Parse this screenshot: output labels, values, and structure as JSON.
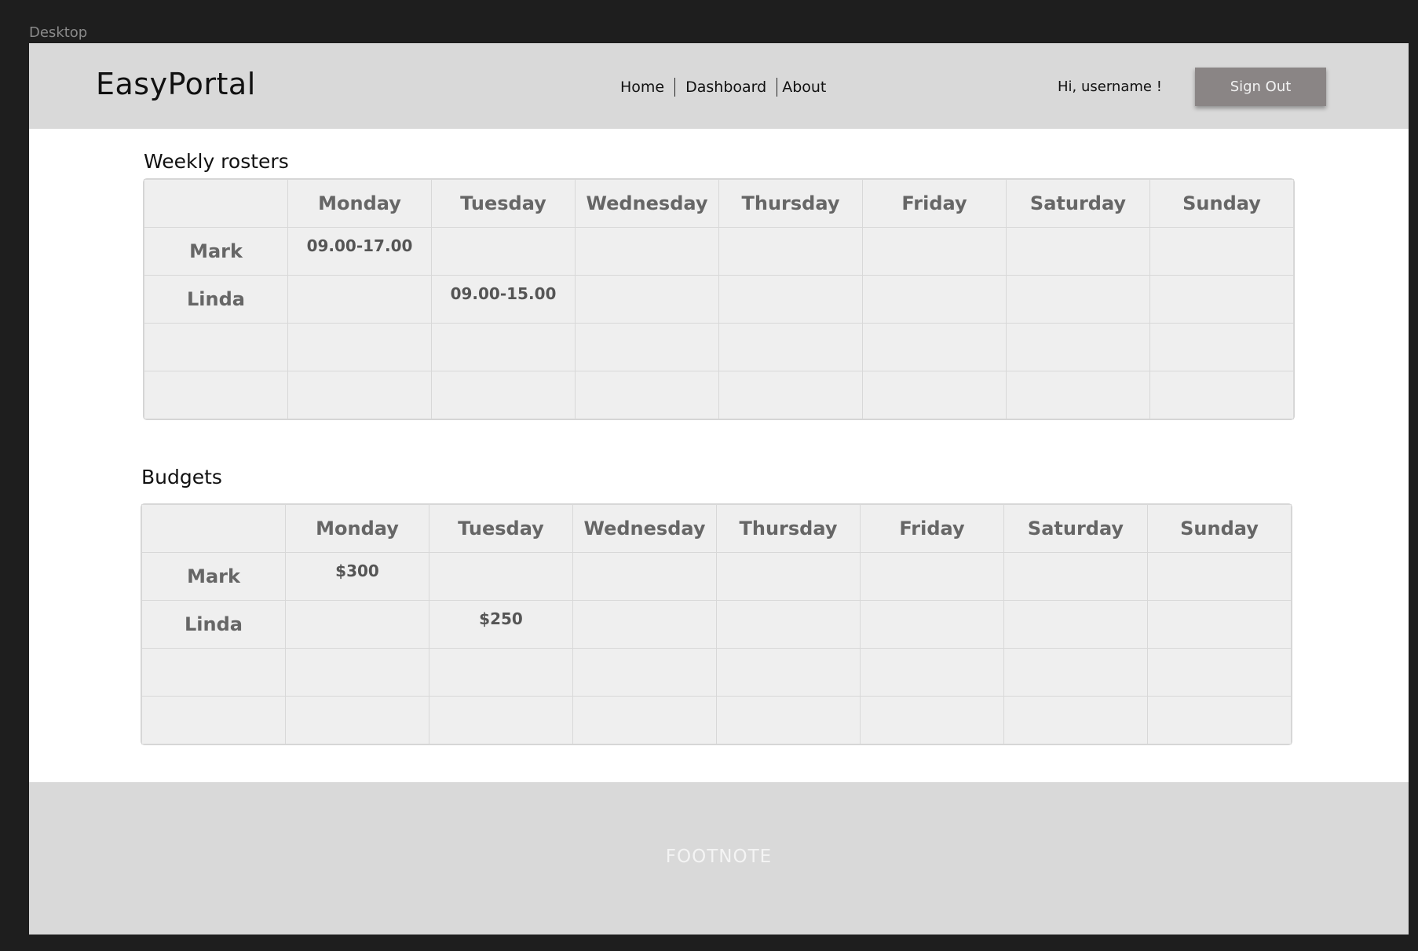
{
  "canvas": {
    "label": "Desktop"
  },
  "header": {
    "logo": "EasyPortal",
    "nav": [
      {
        "label": "Home"
      },
      {
        "label": "Dashboard"
      },
      {
        "label": "About"
      }
    ],
    "greeting": "Hi, username !",
    "signout_label": "Sign Out"
  },
  "rosters": {
    "title": "Weekly rosters",
    "days": [
      "Monday",
      "Tuesday",
      "Wednesday",
      "Thursday",
      "Friday",
      "Saturday",
      "Sunday"
    ],
    "rows": [
      {
        "name": "Mark",
        "cells": [
          "09.00-17.00",
          "",
          "",
          "",
          "",
          "",
          ""
        ]
      },
      {
        "name": "Linda",
        "cells": [
          "",
          "09.00-15.00",
          "",
          "",
          "",
          "",
          ""
        ]
      },
      {
        "name": "",
        "cells": [
          "",
          "",
          "",
          "",
          "",
          "",
          ""
        ]
      },
      {
        "name": "",
        "cells": [
          "",
          "",
          "",
          "",
          "",
          "",
          ""
        ]
      }
    ]
  },
  "budgets": {
    "title": "Budgets",
    "days": [
      "Monday",
      "Tuesday",
      "Wednesday",
      "Thursday",
      "Friday",
      "Saturday",
      "Sunday"
    ],
    "rows": [
      {
        "name": "Mark",
        "cells": [
          "$300",
          "",
          "",
          "",
          "",
          "",
          ""
        ]
      },
      {
        "name": "Linda",
        "cells": [
          "",
          "$250",
          "",
          "",
          "",
          "",
          ""
        ]
      },
      {
        "name": "",
        "cells": [
          "",
          "",
          "",
          "",
          "",
          "",
          ""
        ]
      },
      {
        "name": "",
        "cells": [
          "",
          "",
          "",
          "",
          "",
          "",
          ""
        ]
      }
    ]
  },
  "footer": {
    "text": "FOOTNOTE"
  }
}
